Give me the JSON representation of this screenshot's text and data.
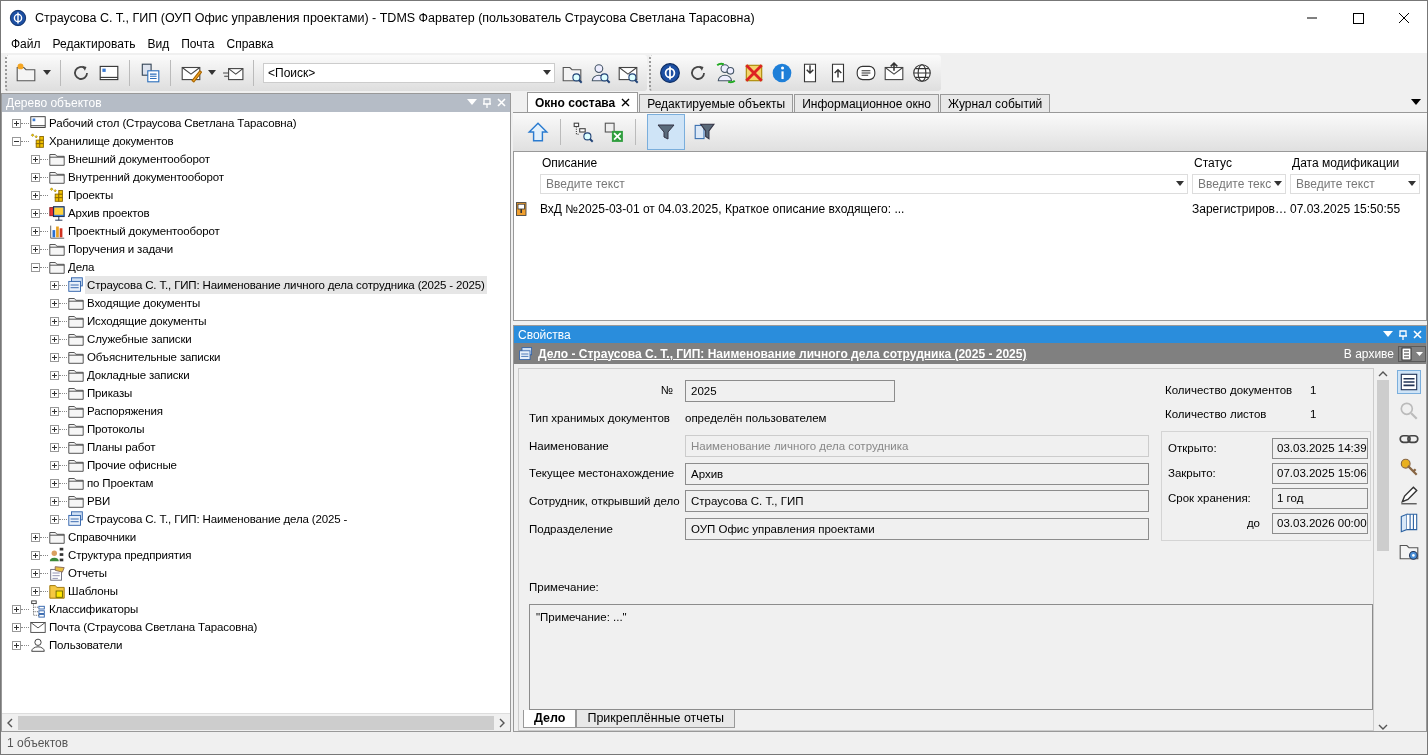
{
  "window": {
    "title": "Страусова С. Т., ГИП (ОУП Офис управления проектами) - TDMS Фарватер (пользователь Страусова Светлана Тарасовна)"
  },
  "menu": [
    "Файл",
    "Редактировать",
    "Вид",
    "Почта",
    "Справка"
  ],
  "search": {
    "value": "<Поиск>"
  },
  "tree_panel": {
    "title": "Дерево объектов",
    "items": [
      {
        "label": "Рабочий стол (Страусова Светлана Тарасовна)",
        "kind": "desktop",
        "expanded": false,
        "selected": false
      },
      {
        "label": "Хранилище документов",
        "kind": "storage",
        "expanded": true,
        "selected": false,
        "children": [
          {
            "label": "Внешний документооборот",
            "kind": "folder",
            "expanded": false,
            "selected": false
          },
          {
            "label": "Внутренний документооборот",
            "kind": "folder",
            "expanded": false,
            "selected": false
          },
          {
            "label": "Проекты",
            "kind": "storage",
            "expanded": false,
            "selected": false
          },
          {
            "label": "Архив проектов",
            "kind": "archive",
            "expanded": false,
            "selected": false
          },
          {
            "label": "Проектный документооборот",
            "kind": "chart",
            "expanded": false,
            "selected": false
          },
          {
            "label": "Поручения и задачи",
            "kind": "folder",
            "expanded": false,
            "selected": false
          },
          {
            "label": "Дела",
            "kind": "folder",
            "expanded": true,
            "selected": false,
            "children": [
              {
                "label": "Страусова С. Т., ГИП:  Наименование личного дела сотрудника (2025 - 2025)",
                "kind": "case",
                "expanded": false,
                "selected": true
              },
              {
                "label": "Входящие документы",
                "kind": "folder",
                "expanded": false,
                "selected": false
              },
              {
                "label": "Исходящие документы",
                "kind": "folder",
                "expanded": false,
                "selected": false
              },
              {
                "label": "Служебные записки",
                "kind": "folder",
                "expanded": false,
                "selected": false
              },
              {
                "label": "Объяснительные записки",
                "kind": "folder",
                "expanded": false,
                "selected": false
              },
              {
                "label": "Докладные записки",
                "kind": "folder",
                "expanded": false,
                "selected": false
              },
              {
                "label": "Приказы",
                "kind": "folder",
                "expanded": false,
                "selected": false
              },
              {
                "label": "Распоряжения",
                "kind": "folder",
                "expanded": false,
                "selected": false
              },
              {
                "label": "Протоколы",
                "kind": "folder",
                "expanded": false,
                "selected": false
              },
              {
                "label": "Планы работ",
                "kind": "folder",
                "expanded": false,
                "selected": false
              },
              {
                "label": "Прочие офисные",
                "kind": "folder",
                "expanded": false,
                "selected": false
              },
              {
                "label": "по Проектам",
                "kind": "folder",
                "expanded": false,
                "selected": false
              },
              {
                "label": "РВИ",
                "kind": "folder",
                "expanded": false,
                "selected": false
              },
              {
                "label": "Страусова С. Т., ГИП:  Наименование дела (2025 -",
                "kind": "case",
                "expanded": false,
                "selected": false
              }
            ]
          },
          {
            "label": "Справочники",
            "kind": "folder",
            "expanded": false,
            "selected": false
          },
          {
            "label": "Структура предприятия",
            "kind": "structure",
            "expanded": false,
            "selected": false
          },
          {
            "label": "Отчеты",
            "kind": "reports",
            "expanded": false,
            "selected": false
          },
          {
            "label": "Шаблоны",
            "kind": "templates",
            "expanded": false,
            "selected": false
          }
        ]
      },
      {
        "label": "Классификаторы",
        "kind": "classifier",
        "expanded": false,
        "selected": false
      },
      {
        "label": "Почта (Страусова Светлана Тарасовна)",
        "kind": "mail",
        "expanded": false,
        "selected": false
      },
      {
        "label": "Пользователи",
        "kind": "users",
        "expanded": false,
        "selected": false
      }
    ]
  },
  "tabs": [
    {
      "label": "Окно состава",
      "selected": true
    },
    {
      "label": "Редактируемые объекты",
      "selected": false
    },
    {
      "label": "Информационное окно",
      "selected": false
    },
    {
      "label": "Журнал событий",
      "selected": false
    }
  ],
  "composition_toolbar": {
    "filter_on": true
  },
  "table": {
    "columns": [
      {
        "title": "Описание",
        "placeholder": "Введите текст"
      },
      {
        "title": "Статус",
        "placeholder": "Введите текс"
      },
      {
        "title": "Дата модификации",
        "placeholder": "Введите текст"
      }
    ],
    "rows": [
      {
        "cells": [
          "ВхД №2025-03-01 от 04.03.2025, Краткое описание входящего: ...",
          "Зарегистриров…",
          "07.03.2025 15:50:55"
        ]
      }
    ]
  },
  "properties": {
    "title": "Свойства",
    "header": {
      "title": "Дело - Страусова С. Т., ГИП:  Наименование личного дела сотрудника (2025 - 2025)",
      "status": "В архиве"
    },
    "fields": [
      {
        "label": "№",
        "value": "2025",
        "kind": "short",
        "disabled": false
      },
      {
        "label": "Тип хранимых документов",
        "value": "определён пользователем",
        "kind": "text",
        "disabled": false
      },
      {
        "label": "Наименование",
        "value": "Наименование личного дела сотрудника",
        "kind": "field",
        "disabled": true
      },
      {
        "label": "Текущее местонахождение",
        "value": "Архив",
        "kind": "field",
        "disabled": false
      },
      {
        "label": "Сотрудник, открывший дело",
        "value": "Страусова С. Т., ГИП",
        "kind": "field",
        "disabled": false
      },
      {
        "label": "Подразделение",
        "value": "ОУП Офис управления проектами",
        "kind": "field",
        "disabled": false
      }
    ],
    "counts": [
      {
        "label": "Количество документов",
        "value": "1"
      },
      {
        "label": "Количество листов",
        "value": "1"
      }
    ],
    "dates": [
      {
        "label": "Открыто:",
        "value": "03.03.2025 14:39",
        "kind": "main"
      },
      {
        "label": "Закрыто:",
        "value": "07.03.2025 15:06",
        "kind": "main"
      },
      {
        "label": "Срок хранения:",
        "value": "1 год",
        "kind": "main"
      },
      {
        "label": "до",
        "value": "03.03.2026 00:00",
        "kind": "sub"
      }
    ],
    "note": {
      "label": "Примечание:",
      "value": "\"Примечание: ...\""
    },
    "tabs": [
      {
        "label": "Дело",
        "selected": true
      },
      {
        "label": "Прикреплённые отчеты",
        "selected": false
      }
    ]
  },
  "status_bar": {
    "text": "1 объектов"
  }
}
